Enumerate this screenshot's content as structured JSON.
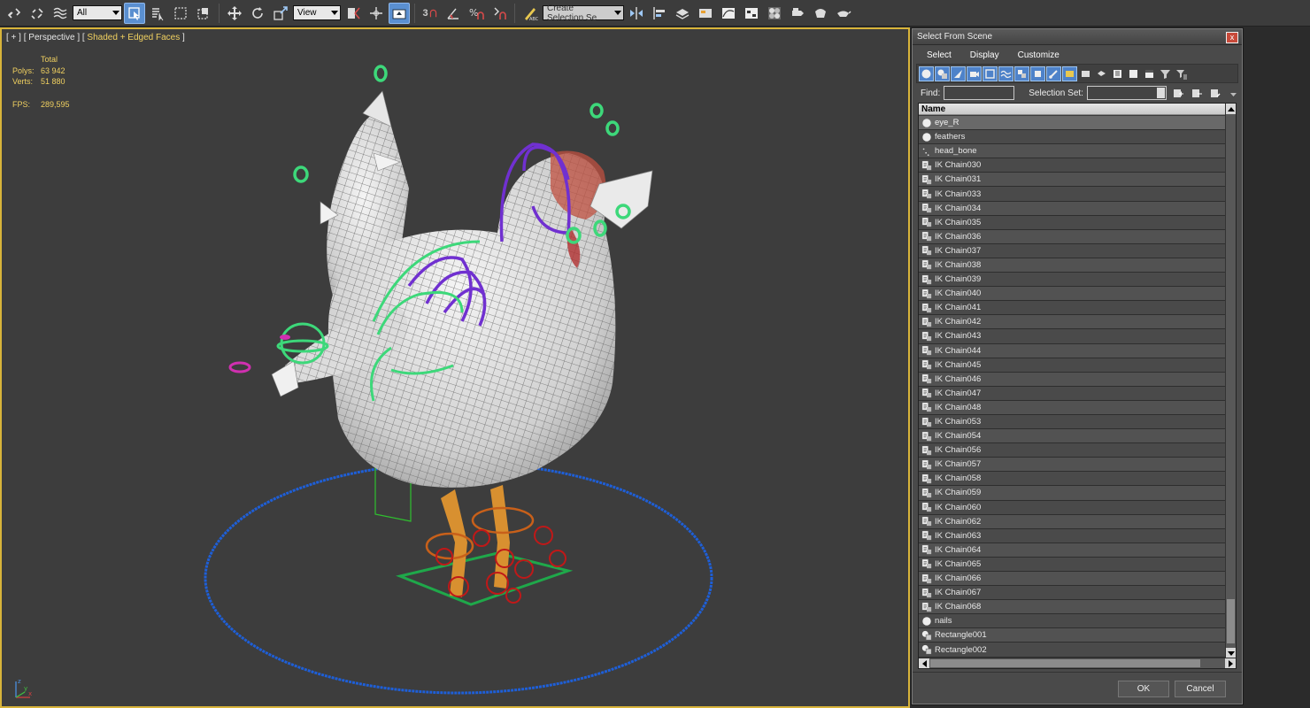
{
  "toolbar": {
    "filter_selected": "All",
    "ref_coord": "View",
    "snap_label": "3",
    "named_selection_placeholder": "Create Selection Se",
    "icons": [
      "link-icon",
      "unlink-icon",
      "bind-icon",
      "select-object-icon",
      "select-by-name-icon",
      "rect-select-icon",
      "window-crossing-icon",
      "move-icon",
      "rotate-icon",
      "scale-icon",
      "pivot-icon",
      "snap-icon",
      "angle-snap-icon",
      "percent-snap-icon",
      "spinner-snap-icon",
      "edit-named-sets-icon",
      "mirror-icon",
      "align-icon",
      "layer-icon",
      "graphite-icon",
      "curve-editor-icon",
      "schematic-icon",
      "material-editor-icon",
      "render-setup-icon",
      "rendered-frame-icon",
      "render-icon"
    ]
  },
  "viewport": {
    "label_prefix": "[ + ] [ Perspective ] [",
    "label_mode": " Shaded + Edged Faces",
    "label_suffix": " ]",
    "stats": {
      "header": "Total",
      "polys_label": "Polys:",
      "polys_value": "63 942",
      "verts_label": "Verts:",
      "verts_value": "51 880",
      "fps_label": "FPS:",
      "fps_value": "289,595"
    },
    "axis": {
      "x": "x",
      "y": "y",
      "z": "z"
    }
  },
  "dialog": {
    "title": "Select From Scene",
    "close": "x",
    "menu": [
      "Select",
      "Display",
      "Customize"
    ],
    "find_label": "Find:",
    "find_value": "",
    "selection_set_label": "Selection Set:",
    "list_header": "Name",
    "items": [
      {
        "name": "eye_R",
        "icon": "sphere",
        "selected": true
      },
      {
        "name": "feathers",
        "icon": "sphere"
      },
      {
        "name": "head_bone",
        "icon": "bone"
      },
      {
        "name": "IK Chain030",
        "icon": "ik"
      },
      {
        "name": "IK Chain031",
        "icon": "ik"
      },
      {
        "name": "IK Chain033",
        "icon": "ik"
      },
      {
        "name": "IK Chain034",
        "icon": "ik"
      },
      {
        "name": "IK Chain035",
        "icon": "ik"
      },
      {
        "name": "IK Chain036",
        "icon": "ik"
      },
      {
        "name": "IK Chain037",
        "icon": "ik"
      },
      {
        "name": "IK Chain038",
        "icon": "ik"
      },
      {
        "name": "IK Chain039",
        "icon": "ik"
      },
      {
        "name": "IK Chain040",
        "icon": "ik"
      },
      {
        "name": "IK Chain041",
        "icon": "ik"
      },
      {
        "name": "IK Chain042",
        "icon": "ik"
      },
      {
        "name": "IK Chain043",
        "icon": "ik"
      },
      {
        "name": "IK Chain044",
        "icon": "ik"
      },
      {
        "name": "IK Chain045",
        "icon": "ik"
      },
      {
        "name": "IK Chain046",
        "icon": "ik"
      },
      {
        "name": "IK Chain047",
        "icon": "ik"
      },
      {
        "name": "IK Chain048",
        "icon": "ik"
      },
      {
        "name": "IK Chain053",
        "icon": "ik"
      },
      {
        "name": "IK Chain054",
        "icon": "ik"
      },
      {
        "name": "IK Chain056",
        "icon": "ik"
      },
      {
        "name": "IK Chain057",
        "icon": "ik"
      },
      {
        "name": "IK Chain058",
        "icon": "ik"
      },
      {
        "name": "IK Chain059",
        "icon": "ik"
      },
      {
        "name": "IK Chain060",
        "icon": "ik"
      },
      {
        "name": "IK Chain062",
        "icon": "ik"
      },
      {
        "name": "IK Chain063",
        "icon": "ik"
      },
      {
        "name": "IK Chain064",
        "icon": "ik"
      },
      {
        "name": "IK Chain065",
        "icon": "ik"
      },
      {
        "name": "IK Chain066",
        "icon": "ik"
      },
      {
        "name": "IK Chain067",
        "icon": "ik"
      },
      {
        "name": "IK Chain068",
        "icon": "ik"
      },
      {
        "name": "nails",
        "icon": "sphere"
      },
      {
        "name": "Rectangle001",
        "icon": "shape"
      },
      {
        "name": "Rectangle002",
        "icon": "shape"
      }
    ],
    "ok_label": "OK",
    "cancel_label": "Cancel"
  },
  "colors": {
    "viewport_border": "#d8b43a",
    "stats_text": "#f0d060",
    "selection_highlight": "#5a8fd0"
  }
}
